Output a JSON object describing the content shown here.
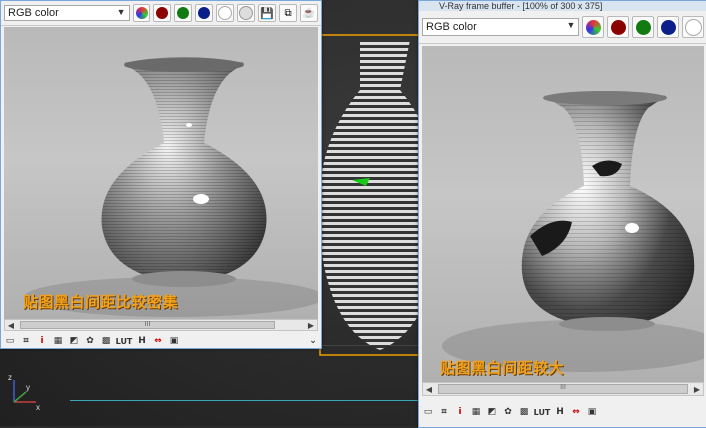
{
  "colors": {
    "accent": "#7aa7d9",
    "caption": "#f2a21a",
    "red": "#8b0000",
    "green": "#117a11",
    "blue": "#0b1f8a",
    "viewport_bg": "#2b2b2b"
  },
  "left_window": {
    "channel_select": "RGB color",
    "caption": "贴图黑白间距比较密集",
    "toolbar_icons": [
      "rgb-channels-icon",
      "red-channel-icon",
      "green-channel-icon",
      "blue-channel-icon",
      "white-channel-icon",
      "mono-icon",
      "save-icon",
      "clone-icon",
      "teapot-icon"
    ],
    "bottom_icons": [
      "window-icon",
      "region-icon",
      "info-icon",
      "histogram-icon",
      "curves-icon",
      "settings-icon",
      "lut-icon",
      "h-icon",
      "compare-icon",
      "stamp-icon"
    ],
    "bottom_labels": {
      "info": "i",
      "lut": "LUT",
      "h": "H"
    }
  },
  "right_window": {
    "title": "V-Ray frame buffer - [100% of 300 x 375]",
    "channel_select": "RGB color",
    "caption": "贴图黑白间距较大",
    "bottom_labels": {
      "info": "i",
      "lut": "LUT",
      "h": "H"
    }
  },
  "viewport": {
    "axis": {
      "x": "x",
      "y": "y",
      "z": "z"
    }
  }
}
